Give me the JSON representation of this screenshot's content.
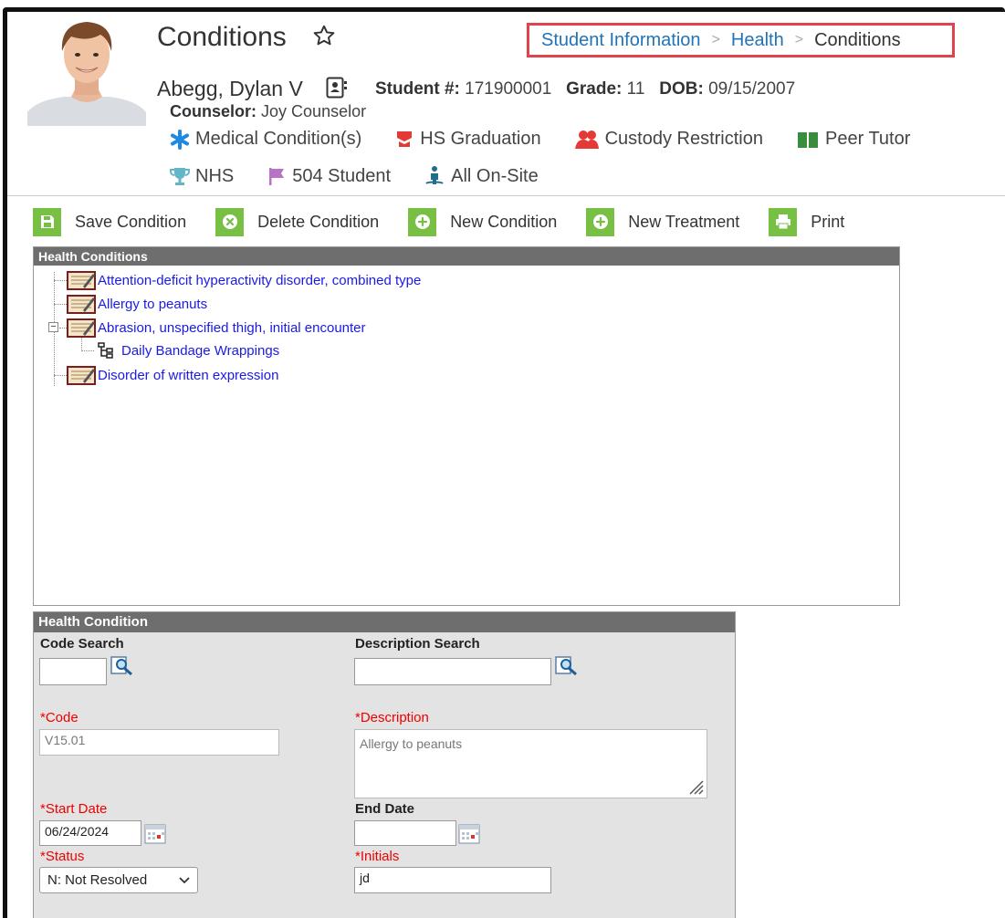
{
  "header": {
    "page_title": "Conditions",
    "breadcrumb": [
      {
        "label": "Student Information",
        "link": true
      },
      {
        "label": "Health",
        "link": true
      },
      {
        "label": "Conditions",
        "link": false
      }
    ],
    "student": {
      "name": "Abegg, Dylan V",
      "student_number_label": "Student #:",
      "student_number": "171900001",
      "grade_label": "Grade:",
      "grade": "11",
      "dob_label": "DOB:",
      "dob": "09/15/2007",
      "counselor_label": "Counselor:",
      "counselor": "Joy Counselor"
    },
    "flags_row1": [
      {
        "icon": "asterisk-icon",
        "label": "Medical Condition(s)",
        "color": "#1e88e5"
      },
      {
        "icon": "graduation-cap-icon",
        "label": "HS Graduation",
        "color": "#e53935"
      },
      {
        "icon": "users-icon",
        "label": "Custody Restriction",
        "color": "#e53935"
      },
      {
        "icon": "book-icon",
        "label": "Peer Tutor",
        "color": "#388e3c"
      }
    ],
    "flags_row2": [
      {
        "icon": "trophy-icon",
        "label": "NHS",
        "color": "#64b5c8"
      },
      {
        "icon": "flag-icon",
        "label": "504 Student",
        "color": "#b872c6"
      },
      {
        "icon": "person-onsite-icon",
        "label": "All On-Site",
        "color": "#1f6e8c"
      }
    ]
  },
  "toolbar": {
    "save": "Save Condition",
    "delete": "Delete Condition",
    "new_condition": "New Condition",
    "new_treatment": "New Treatment",
    "print": "Print"
  },
  "tree": {
    "header": "Health Conditions",
    "items": [
      {
        "label": "Attention-deficit hyperactivity disorder, combined type"
      },
      {
        "label": "Allergy to peanuts"
      },
      {
        "label": "Abrasion, unspecified thigh, initial encounter"
      },
      {
        "label": "Daily Bandage Wrappings"
      },
      {
        "label": "Disorder of written expression"
      }
    ]
  },
  "detail": {
    "header": "Health Condition",
    "code_search_label": "Code Search",
    "code_search_value": "",
    "description_search_label": "Description Search",
    "description_search_value": "",
    "code_label": "*Code",
    "code_value": "V15.01",
    "description_label": "*Description",
    "description_value": "Allergy to peanuts",
    "start_date_label": "*Start Date",
    "start_date_value": "06/24/2024",
    "end_date_label": "End Date",
    "end_date_value": "",
    "status_label": "*Status",
    "status_value": "N: Not Resolved",
    "initials_label": "*Initials",
    "initials_value": "jd"
  }
}
